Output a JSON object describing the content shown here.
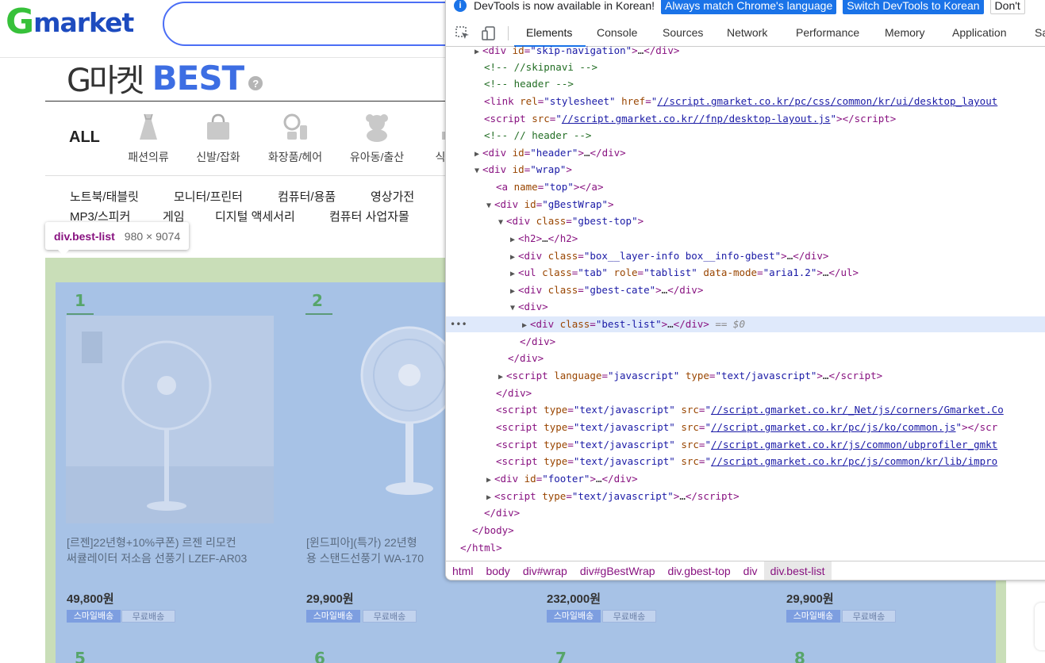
{
  "gmarket": {
    "logo_g": "G",
    "logo_rest": "market",
    "best_title_kr": "G마켓",
    "best_title_en": "BEST",
    "help": "?",
    "category_all": "ALL",
    "categories": [
      {
        "label": "패션의류",
        "icon": "dress-icon"
      },
      {
        "label": "신발/잡화",
        "icon": "bag-icon"
      },
      {
        "label": "화장품/헤어",
        "icon": "cosmetics-icon"
      },
      {
        "label": "유아동/출산",
        "icon": "teddy-bear-icon"
      },
      {
        "label": "식",
        "icon": "food-icon"
      }
    ],
    "subcategories_row1": [
      "노트북/태블릿",
      "모니터/프린터",
      "컴퓨터/용품",
      "영상가전"
    ],
    "subcategories_row2": [
      "MP3/스피커",
      "게임",
      "디지털 액세서리",
      "컴퓨터 사업자몰"
    ],
    "products": [
      {
        "rank": "1",
        "name_line1": "[르젠]22년형+10%쿠폰) 르젠 리모컨",
        "name_line2": "써큘레이터 저소음 선풍기 LZEF-AR03",
        "price": "49,800원",
        "tag1": "스마일배송",
        "tag2": "무료배송"
      },
      {
        "rank": "2",
        "name_line1": "[윈드피아](특가) 22년형",
        "name_line2": "용 스탠드선풍기 WA-170",
        "price": "29,900원",
        "tag1": "스마일배송",
        "tag2": "무료배송"
      },
      {
        "rank": "",
        "name_line1": "",
        "name_line2": "",
        "price": "232,000원",
        "tag1": "스마일배송",
        "tag2": "무료배송"
      },
      {
        "rank": "",
        "name_line1": "",
        "name_line2": "",
        "price": "29,900원",
        "tag1": "스마일배송",
        "tag2": "무료배송"
      }
    ],
    "next_ranks": [
      "5",
      "6",
      "7",
      "8"
    ],
    "inspect_tooltip": {
      "tag": "div",
      "cls": ".best-list",
      "dims": "980 × 9074"
    }
  },
  "devtools": {
    "infobar": {
      "message": "DevTools is now available in Korean!",
      "btn_match": "Always match Chrome's language",
      "btn_switch": "Switch DevTools to Korean",
      "btn_dont": "Don't"
    },
    "tabs": [
      "Elements",
      "Console",
      "Sources",
      "Network",
      "Performance",
      "Memory",
      "Application",
      "Sa"
    ],
    "active_tab": "Elements",
    "selected_suffix": "== $0",
    "breadcrumbs": [
      "html",
      "body",
      "div#wrap",
      "div#gBestWrap",
      "div.gbest-top",
      "div",
      "div.best-list"
    ]
  },
  "colors": {
    "gmarket_green": "#37c13a",
    "gmarket_blue": "#1d4bbf",
    "best_blue": "#3d6ee3",
    "highlight_content": "#a7c2e6",
    "highlight_margin": "#c9deb8",
    "chrome_blue": "#1a73e8"
  }
}
